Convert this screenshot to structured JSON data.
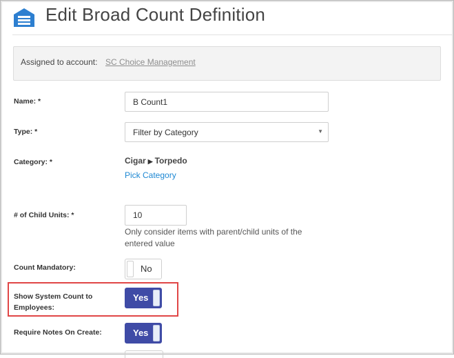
{
  "header": {
    "title": "Edit Broad Count Definition",
    "icon": "inventory-box-icon"
  },
  "account": {
    "label": "Assigned to account:",
    "link": "SC Choice Management"
  },
  "form": {
    "name": {
      "label": "Name: *",
      "value": "B Count1"
    },
    "type": {
      "label": "Type: *",
      "value": "Filter by Category"
    },
    "category": {
      "label": "Category: *",
      "path_parent": "Cigar",
      "path_child": "Torpedo",
      "pick_link": "Pick Category"
    },
    "child_units": {
      "label": "# of Child Units: *",
      "value": "10",
      "help_line1": "Only consider items with parent/child units of the",
      "help_line2": "entered value"
    },
    "count_mandatory": {
      "label": "Count Mandatory:",
      "toggle": "No"
    },
    "show_system_count": {
      "label_line1": "Show System Count to",
      "label_line2": "Employees:",
      "toggle": "Yes"
    },
    "require_notes": {
      "label": "Require Notes On Create:",
      "toggle": "Yes"
    }
  },
  "colors": {
    "toggle_on": "#3f4ba6",
    "link": "#1e88d3",
    "highlight": "#e04545",
    "header_icon": "#2d7fd0"
  }
}
